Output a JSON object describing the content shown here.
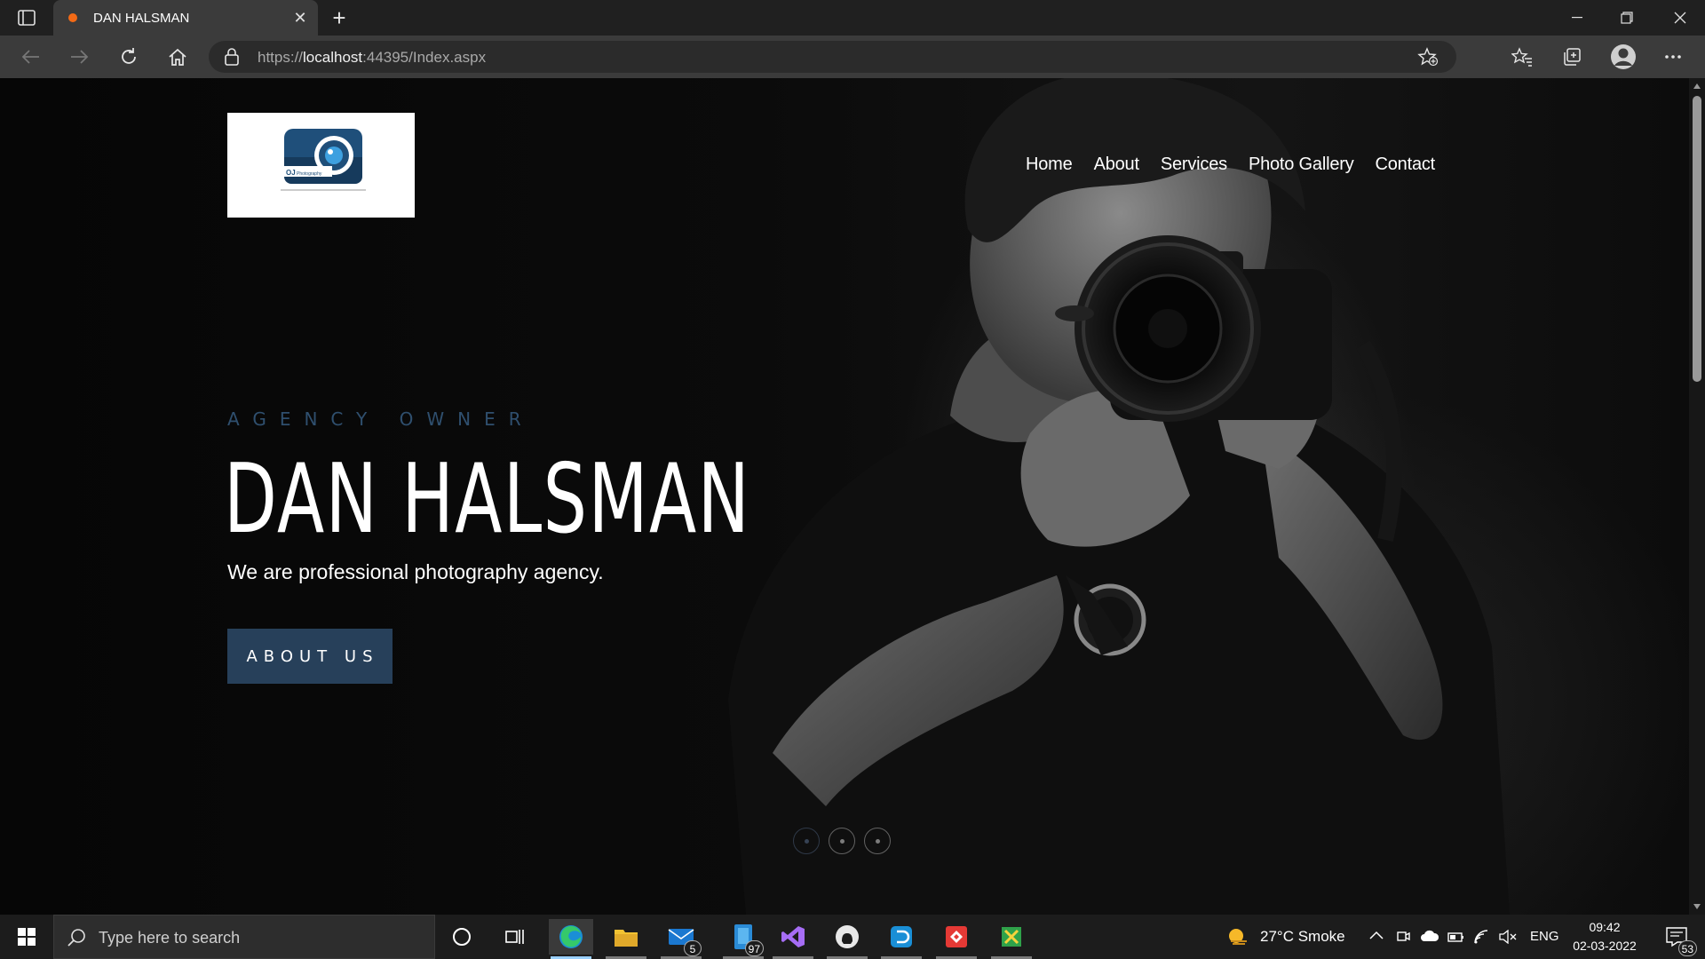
{
  "browser": {
    "tab_title": "DAN HALSMAN",
    "url_scheme": "https://",
    "url_host": "localhost",
    "url_rest": ":44395/Index.aspx"
  },
  "site": {
    "logo_text": "OJ Photography",
    "nav": [
      "Home",
      "About",
      "Services",
      "Photo Gallery",
      "Contact"
    ],
    "kicker": "AGENCY OWNER",
    "headline": "DAN HALSMAN",
    "subline": "We are professional photography agency.",
    "button": "ABOUT US",
    "slides": 3,
    "active_slide": 1
  },
  "taskbar": {
    "search_placeholder": "Type here to search",
    "mail_badge": "5",
    "app_badge": "97",
    "weather": "27°C  Smoke",
    "language": "ENG",
    "time": "09:42",
    "date": "02-03-2022",
    "notifications": "53"
  },
  "colors": {
    "accent": "#27405a",
    "kicker": "#2f4f6e",
    "tab_dot": "#f36a16"
  }
}
